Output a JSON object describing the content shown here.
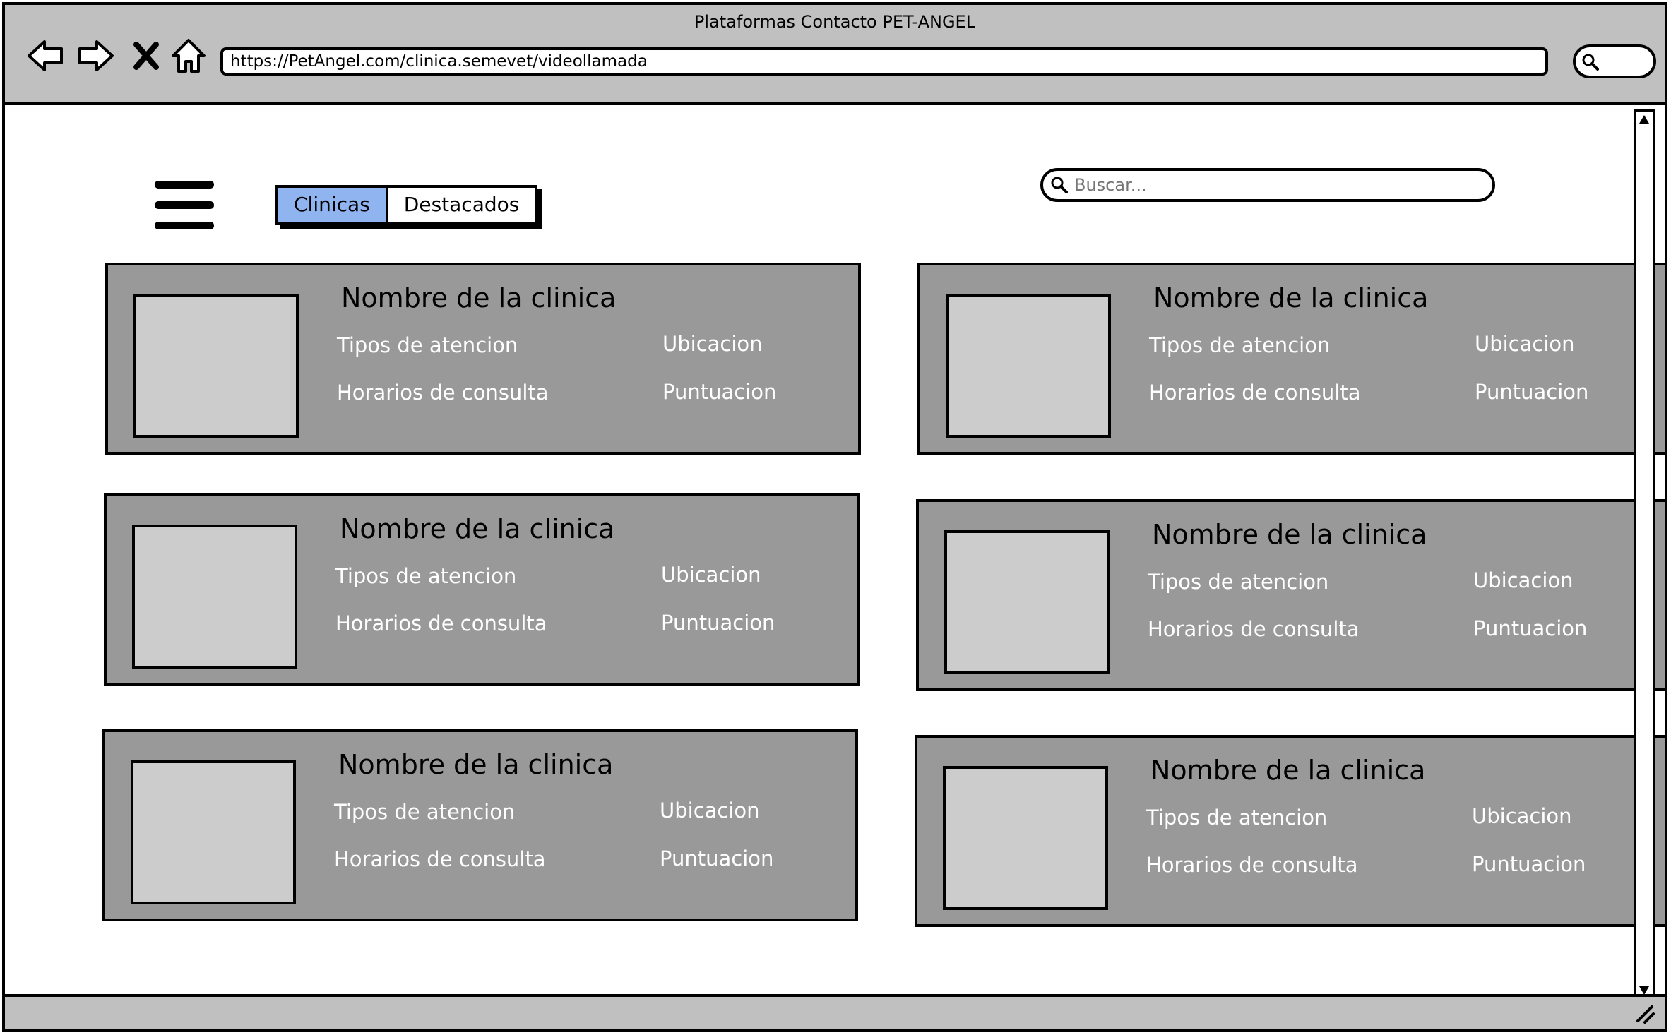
{
  "window": {
    "title": "Plataformas Contacto PET-ANGEL",
    "url": "https://PetAngel.com/clinica.semevet/videollamada"
  },
  "toolbar": {
    "back_icon": "arrow-left-icon",
    "forward_icon": "arrow-right-icon",
    "stop_icon": "close-icon",
    "home_icon": "home-icon",
    "search_icon": "search-icon"
  },
  "tabs": [
    {
      "label": "Clinicas",
      "active": true
    },
    {
      "label": "Destacados",
      "active": false
    }
  ],
  "search": {
    "placeholder": "Buscar..."
  },
  "colors": {
    "card_bg": "#999999",
    "thumb_bg": "#cccccc",
    "active_tab": "#8fb4f0",
    "chrome": "#c0c0c0"
  },
  "clinics": [
    {
      "name": "Nombre de la clinica",
      "tipos": "Tipos de atencion",
      "horarios": "Horarios de consulta",
      "ubicacion": "Ubicacion",
      "puntuacion": "Puntuacion"
    },
    {
      "name": "Nombre de la clinica",
      "tipos": "Tipos de atencion",
      "horarios": "Horarios de consulta",
      "ubicacion": "Ubicacion",
      "puntuacion": "Puntuacion"
    },
    {
      "name": "Nombre de la clinica",
      "tipos": "Tipos de atencion",
      "horarios": "Horarios de consulta",
      "ubicacion": "Ubicacion",
      "puntuacion": "Puntuacion"
    },
    {
      "name": "Nombre de la clinica",
      "tipos": "Tipos de atencion",
      "horarios": "Horarios de consulta",
      "ubicacion": "Ubicacion",
      "puntuacion": "Puntuacion"
    },
    {
      "name": "Nombre de la clinica",
      "tipos": "Tipos de atencion",
      "horarios": "Horarios de consulta",
      "ubicacion": "Ubicacion",
      "puntuacion": "Puntuacion"
    },
    {
      "name": "Nombre de la clinica",
      "tipos": "Tipos de atencion",
      "horarios": "Horarios de consulta",
      "ubicacion": "Ubicacion",
      "puntuacion": "Puntuacion"
    }
  ]
}
